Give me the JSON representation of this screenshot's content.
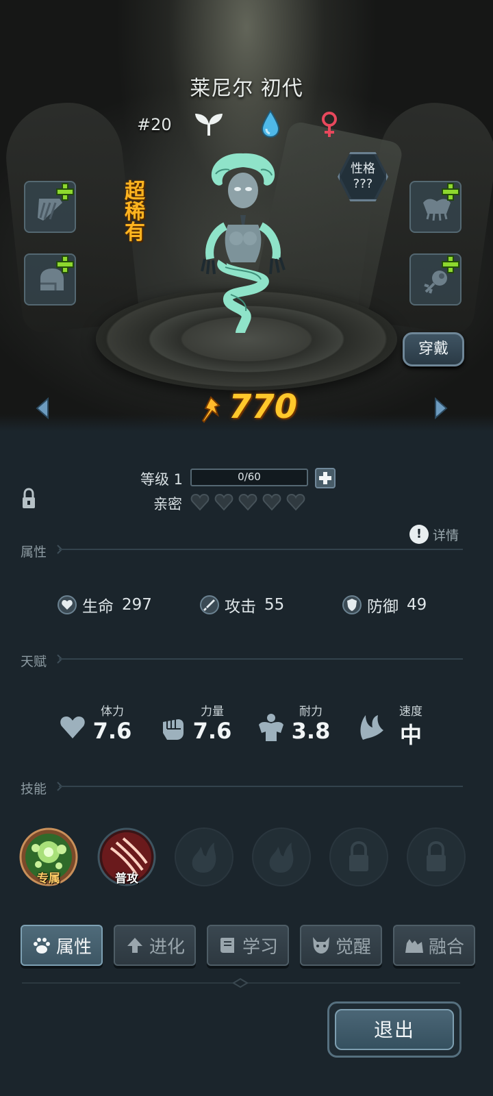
{
  "hero": {
    "name": "莱尼尔 初代",
    "number": "#20",
    "rarity": "超稀有",
    "personality_label": "性格",
    "personality_value": "???",
    "power": "770",
    "type_icons": [
      "sprout-icon",
      "water-drop-icon",
      "female-icon"
    ]
  },
  "equipment": {
    "slots": [
      "claw-slot",
      "helmet-slot",
      "chestpiece-slot",
      "accessory-slot"
    ],
    "wear_label": "穿戴"
  },
  "progress": {
    "level_label": "等级 1",
    "exp_text": "0/60",
    "exp_fraction": 0,
    "intimacy_label": "亲密",
    "intimacy_filled": 0,
    "intimacy_max": 5
  },
  "attributes": {
    "section_title": "属性",
    "details_label": "详情",
    "items": [
      {
        "label": "生命",
        "value": "297"
      },
      {
        "label": "攻击",
        "value": "55"
      },
      {
        "label": "防御",
        "value": "49"
      }
    ]
  },
  "talents": {
    "section_title": "天赋",
    "items": [
      {
        "label": "体力",
        "value": "7.6"
      },
      {
        "label": "力量",
        "value": "7.6"
      },
      {
        "label": "耐力",
        "value": "3.8"
      },
      {
        "label": "速度",
        "value": "中"
      }
    ]
  },
  "skills": {
    "section_title": "技能",
    "items": [
      {
        "label": "专属",
        "state": "unlocked"
      },
      {
        "label": "普攻",
        "state": "unlocked"
      },
      {
        "label": "",
        "state": "empty"
      },
      {
        "label": "",
        "state": "empty"
      },
      {
        "label": "",
        "state": "locked"
      },
      {
        "label": "",
        "state": "locked"
      }
    ]
  },
  "tabs": [
    {
      "label": "属性",
      "active": true
    },
    {
      "label": "进化",
      "active": false
    },
    {
      "label": "学习",
      "active": false
    },
    {
      "label": "觉醒",
      "active": false
    },
    {
      "label": "融合",
      "active": false
    }
  ],
  "exit_label": "退出",
  "colors": {
    "background": "#1b252c",
    "rarity": "#ffb41f",
    "power": "#ffc82b",
    "plus": "#8ed82e",
    "female": "#e8485c",
    "water": "#4fb8e8"
  }
}
